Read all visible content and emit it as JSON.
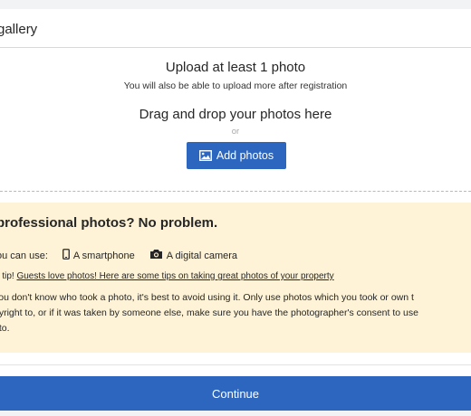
{
  "section": {
    "title": "gallery"
  },
  "upload": {
    "heading": "Upload at least 1 photo",
    "subtext": "You will also be able to upload more after registration",
    "drag_text": "Drag and drop your photos here",
    "or_text": "or",
    "add_button_label": "Add photos",
    "add_button_icon": "image-icon"
  },
  "tips": {
    "heading": "professional photos? No problem.",
    "use_prefix": "ou can use:",
    "options": [
      {
        "icon": "smartphone-icon",
        "label": "A smartphone"
      },
      {
        "icon": "camera-icon",
        "label": "A digital camera"
      }
    ],
    "tip_prefix": "p tip!",
    "tip_link": "Guests love photos! Here are some tips on taking great photos of your property",
    "note_lines": [
      "you don't know who took a photo, it's best to avoid using it. Only use photos which you took or own t",
      "pyright to, or if it was taken by someone else, make sure you have the photographer's consent to use",
      "oto."
    ],
    "background_color": "#fef3d6"
  },
  "footer": {
    "continue_label": "Continue"
  },
  "colors": {
    "accent": "#2c66bf"
  }
}
